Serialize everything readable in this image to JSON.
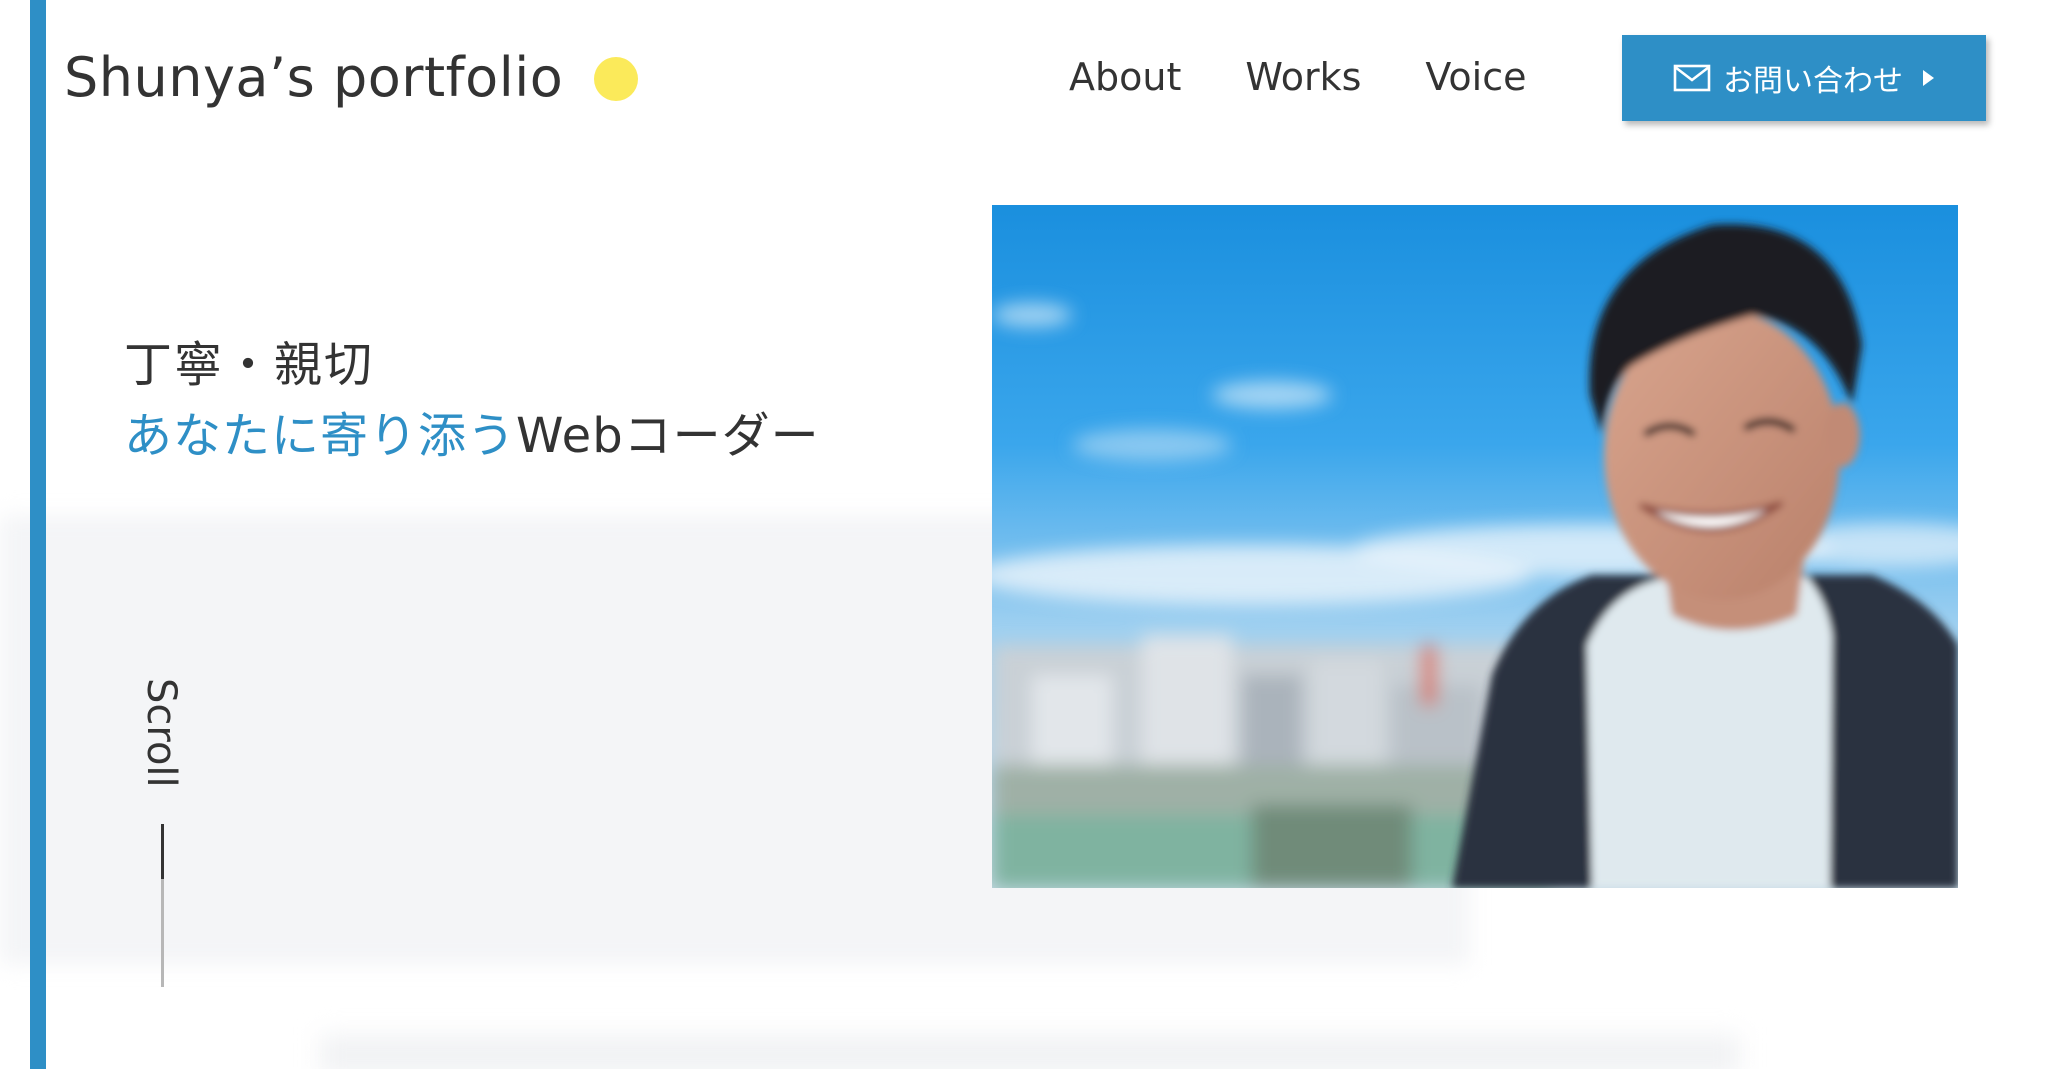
{
  "header": {
    "logo_text": "Shunya’s portfolio",
    "nav": [
      {
        "label": "About"
      },
      {
        "label": "Works"
      },
      {
        "label": "Voice"
      }
    ],
    "contact_button": {
      "label": "お問い合わせ",
      "icon": "mail-icon",
      "arrow_icon": "triangle-right-icon"
    }
  },
  "hero": {
    "line1": "丁寧・親切",
    "line2_accent": "あなたに寄り添う",
    "line2_rest": "Webコーダー",
    "photo": "portrait-photo"
  },
  "scroll_indicator": {
    "label": "Scroll"
  },
  "colors": {
    "accent": "#2e8fc6",
    "dot": "#fbea5a",
    "text": "#333333"
  }
}
